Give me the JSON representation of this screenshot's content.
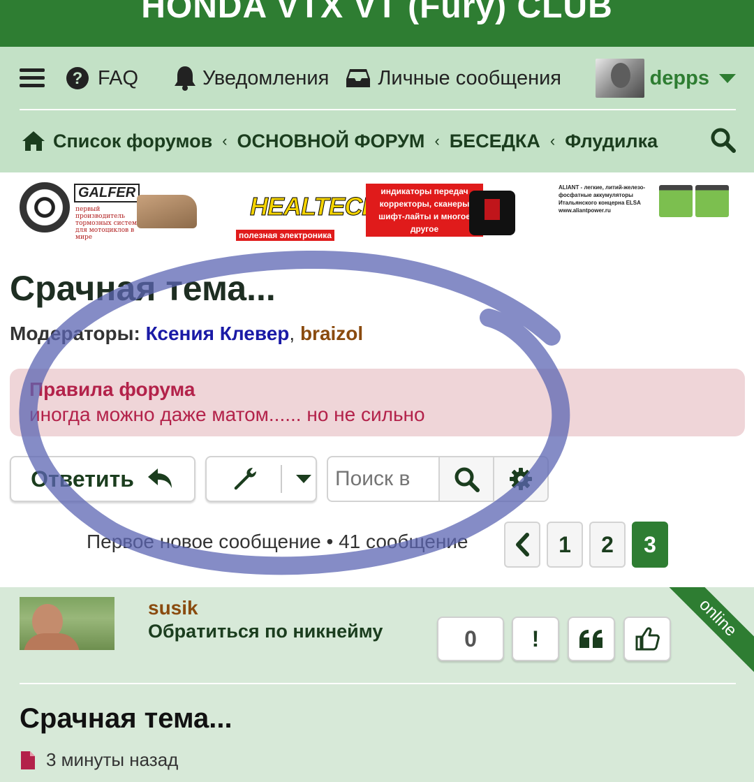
{
  "site": {
    "title": "HONDA VTX VT (Fury) CLUB"
  },
  "nav": {
    "menu_icon": "hamburger-icon",
    "faq_label": "FAQ",
    "notifications_label": "Уведомления",
    "messages_label": "Личные сообщения",
    "username": "depps"
  },
  "breadcrumb": {
    "home_label": "Список форумов",
    "items": [
      "ОСНОВНОЙ ФОРУМ",
      "БЕСЕДКА",
      "Флудилка"
    ],
    "separator": "‹"
  },
  "banners": {
    "galfer": {
      "brand": "GALFER",
      "tagline": "первый производитель тормозных систем для мотоциклов в мире"
    },
    "healtech": {
      "brand": "HEALTECH",
      "subtitle": "полезная электроника",
      "promo": "индикаторы передач корректоры, сканеры шифт-лайты и многое другое"
    },
    "aliant": {
      "text": "ALIANT - легкие, литий-железо-фосфатные аккумуляторы Итальянского концерна ELSA www.aliantpower.ru"
    }
  },
  "thread": {
    "title": "Срачная тема...",
    "moderators_label": "Модераторы:",
    "moderator_1": "Ксения Клевер",
    "comma": ",",
    "moderator_2": "braizol"
  },
  "rules": {
    "title": "Правила форума",
    "text": "иногда можно даже матом...... но не сильно"
  },
  "actions": {
    "reply_label": "Ответить",
    "search_placeholder": "Поиск в"
  },
  "pagination": {
    "info": "Первое новое сообщение • 41 сообщение",
    "pages": [
      "1",
      "2",
      "3"
    ],
    "current": "3"
  },
  "post": {
    "author": "susik",
    "mention_label": "Обратиться по никнейму",
    "reputation": "0",
    "report_label": "!",
    "status_badge": "online",
    "title": "Срачная тема...",
    "time": "3 минуты назад"
  },
  "colors": {
    "header_green": "#2e7d32",
    "nav_bg": "#c3e1c6",
    "post_bg": "#d7e9d8",
    "rules_bg": "#efd5d8",
    "rules_text": "#b3224a",
    "moderator_1": "#1a1aa6",
    "moderator_2": "#8a4b0f",
    "scribble": "#5c66b3"
  }
}
